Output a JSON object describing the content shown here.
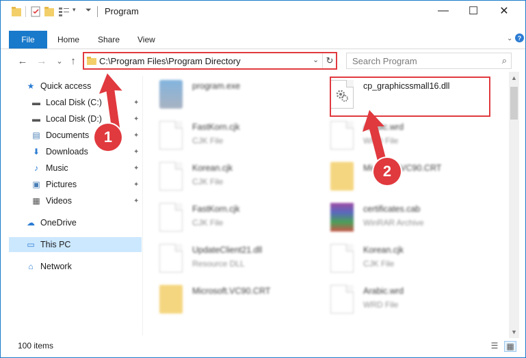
{
  "window": {
    "title": "Program",
    "minimize_glyph": "—",
    "maximize_glyph": "☐",
    "close_glyph": "✕"
  },
  "ribbon": {
    "tabs": [
      "File",
      "Home",
      "Share",
      "View"
    ]
  },
  "nav": {
    "back_glyph": "←",
    "forward_glyph": "→",
    "recent_glyph": "⌄",
    "up_glyph": "↑"
  },
  "address": {
    "path": "C:\\Program Files\\Program Directory",
    "dropdown_glyph": "⌄",
    "refresh_glyph": "↻"
  },
  "search": {
    "placeholder": "Search Program",
    "icon_glyph": "⌕"
  },
  "sidebar": {
    "items": [
      {
        "label": "Quick access",
        "icon": "star-icon",
        "glyph": "★",
        "color": "#2b7cd3",
        "pinned": false
      },
      {
        "label": "Local Disk (C:)",
        "icon": "drive-icon",
        "glyph": "▬",
        "color": "#555555",
        "pinned": true
      },
      {
        "label": "Local Disk (D:)",
        "icon": "drive-icon",
        "glyph": "▬",
        "color": "#555555",
        "pinned": true
      },
      {
        "label": "Documents",
        "icon": "documents-icon",
        "glyph": "▤",
        "color": "#4a7fb5",
        "pinned": true
      },
      {
        "label": "Downloads",
        "icon": "download-icon",
        "glyph": "⬇",
        "color": "#2b7cd3",
        "pinned": true
      },
      {
        "label": "Music",
        "icon": "music-icon",
        "glyph": "♪",
        "color": "#2b7cd3",
        "pinned": true
      },
      {
        "label": "Pictures",
        "icon": "pictures-icon",
        "glyph": "▣",
        "color": "#4a7fb5",
        "pinned": true
      },
      {
        "label": "Videos",
        "icon": "videos-icon",
        "glyph": "▦",
        "color": "#555555",
        "pinned": true
      },
      {
        "label": "OneDrive",
        "icon": "onedrive-icon",
        "glyph": "☁",
        "color": "#2b7cd3",
        "pinned": false
      },
      {
        "label": "This PC",
        "icon": "computer-icon",
        "glyph": "▭",
        "color": "#2b7cd3",
        "pinned": false
      },
      {
        "label": "Network",
        "icon": "network-icon",
        "glyph": "⌂",
        "color": "#2b7cd3",
        "pinned": false
      }
    ],
    "pin_glyph": "📌"
  },
  "files": [
    {
      "name": "program.exe",
      "type": "",
      "icon": "exe-icon",
      "blurred": true
    },
    {
      "name": "cp_graphicssmall16.dll",
      "type": "",
      "icon": "dll-icon",
      "blurred": false
    },
    {
      "name": "FastKorn.cjk",
      "type": "CJK File",
      "icon": "document-icon",
      "blurred": true
    },
    {
      "name": "Arabic.wrd",
      "type": "WRD File",
      "icon": "document-icon",
      "blurred": true
    },
    {
      "name": "Korean.cjk",
      "type": "CJK File",
      "icon": "document-icon",
      "blurred": true
    },
    {
      "name": "Microsoft.VC90.CRT",
      "type": "",
      "icon": "folder-icon",
      "blurred": true
    },
    {
      "name": "FastKorn.cjk",
      "type": "CJK File",
      "icon": "document-icon",
      "blurred": true
    },
    {
      "name": "certificates.cab",
      "type": "WinRAR Archive",
      "icon": "archive-icon",
      "blurred": true
    },
    {
      "name": "UpdateClient21.dll",
      "type": "Resource DLL",
      "icon": "dll-icon",
      "blurred": true
    },
    {
      "name": "Korean.cjk",
      "type": "CJK File",
      "icon": "document-icon",
      "blurred": true
    },
    {
      "name": "Microsoft.VC90.CRT",
      "type": "",
      "icon": "folder-icon",
      "blurred": true
    },
    {
      "name": "Arabic.wrd",
      "type": "WRD File",
      "icon": "document-icon",
      "blurred": true
    }
  ],
  "status": {
    "item_count": "100 items"
  },
  "annotations": {
    "step1": "1",
    "step2": "2",
    "color": "#e0393e"
  },
  "colors": {
    "accent": "#1979ca",
    "selection": "#cce8ff",
    "highlight": "#e0393e"
  }
}
